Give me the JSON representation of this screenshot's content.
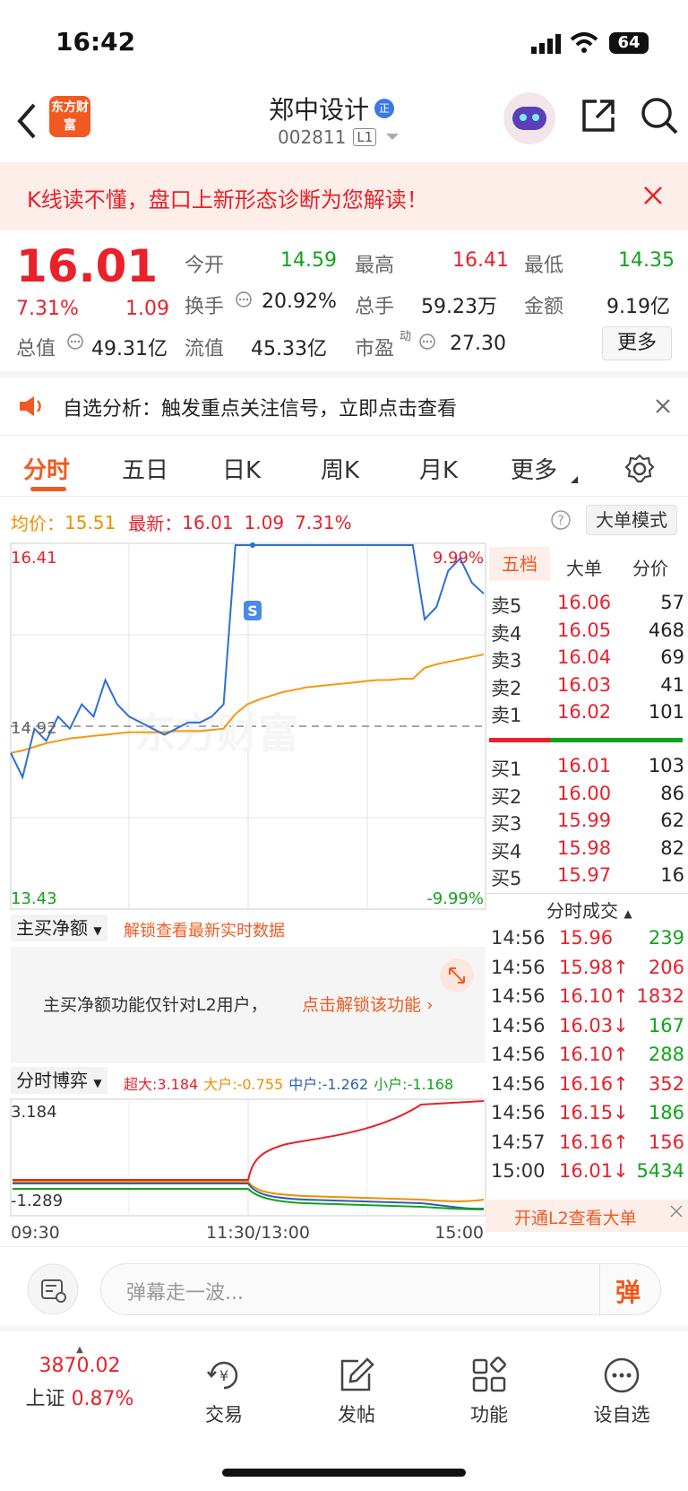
{
  "status": {
    "time": "16:42",
    "battery": "64"
  },
  "header": {
    "logo": "东方财富",
    "stock_name": "郑中设计",
    "stock_code": "002811",
    "level": "L1",
    "badge": "正"
  },
  "banner": {
    "text": "K线读不懂，盘口上新形态诊断为您解读！"
  },
  "quote": {
    "price": "16.01",
    "change_pct": "7.31%",
    "change": "1.09",
    "open_label": "今开",
    "open": "14.59",
    "high_label": "最高",
    "high": "16.41",
    "low_label": "最低",
    "low": "14.35",
    "turnover_label": "换手",
    "turnover": "20.92%",
    "volume_label": "总手",
    "volume": "59.23万",
    "amount_label": "金额",
    "amount": "9.19亿",
    "mcap_label": "总值",
    "mcap": "49.31亿",
    "float_label": "流值",
    "float": "45.33亿",
    "pe_label": "市盈",
    "pe_sup": "动",
    "pe": "27.30",
    "more_button": "更多"
  },
  "notice": {
    "text": "自选分析：触发重点关注信号，立即点击查看"
  },
  "tabs": [
    "分时",
    "五日",
    "日K",
    "周K",
    "月K",
    "更多"
  ],
  "info_line": {
    "avg_label": "均价：",
    "avg": "15.51",
    "last_label": "最新：",
    "last": "16.01",
    "change": "1.09",
    "pct": "7.31%",
    "mode_button": "大单模式"
  },
  "chart": {
    "top_price": "16.41",
    "top_pct": "9.99%",
    "bottom_price": "13.43",
    "bottom_pct": "-9.99%",
    "mid_label": "14.92",
    "signal": "S",
    "watermark": "东方财富",
    "times": [
      "09:30",
      "11:30/13:00",
      "15:00"
    ]
  },
  "chart_data": {
    "type": "line",
    "ylim": [
      13.43,
      16.41
    ],
    "series": [
      {
        "name": "price",
        "values": [
          14.7,
          14.5,
          14.9,
          14.8,
          15.0,
          14.9,
          15.1,
          15.0,
          15.3,
          15.1,
          15.0,
          14.95,
          14.9,
          14.85,
          14.9,
          14.95,
          14.95,
          15.0,
          15.1,
          16.41,
          16.41,
          16.41,
          16.41,
          16.41,
          16.41,
          16.41,
          16.41,
          16.41,
          16.41,
          16.41,
          16.41,
          16.41,
          16.41,
          16.41,
          16.41,
          15.8,
          15.9,
          16.2,
          16.3,
          16.1,
          16.01
        ]
      },
      {
        "name": "avg",
        "values": [
          14.7,
          14.72,
          14.75,
          14.78,
          14.8,
          14.82,
          14.83,
          14.84,
          14.85,
          14.86,
          14.87,
          14.87,
          14.87,
          14.87,
          14.88,
          14.88,
          14.88,
          14.89,
          14.9,
          15.02,
          15.1,
          15.14,
          15.17,
          15.2,
          15.22,
          15.24,
          15.25,
          15.26,
          15.27,
          15.28,
          15.29,
          15.3,
          15.3,
          15.31,
          15.31,
          15.4,
          15.43,
          15.45,
          15.47,
          15.49,
          15.51
        ]
      }
    ]
  },
  "mainbuy": {
    "label": "主买净额",
    "unlock": "解锁查看最新实时数据",
    "msg": "主买净额功能仅针对L2用户，",
    "link": "点击解锁该功能"
  },
  "game": {
    "label": "分时博弈",
    "super": "超大:3.184",
    "large": "大户:-0.755",
    "mid": "中户:-1.262",
    "small": "小户:-1.168",
    "top": "3.184",
    "bottom": "-1.289"
  },
  "orderbook": {
    "tabs": [
      "五档",
      "大单",
      "分价"
    ],
    "asks": [
      {
        "label": "卖5",
        "price": "16.06",
        "vol": "57"
      },
      {
        "label": "卖4",
        "price": "16.05",
        "vol": "468"
      },
      {
        "label": "卖3",
        "price": "16.04",
        "vol": "69"
      },
      {
        "label": "卖2",
        "price": "16.03",
        "vol": "41"
      },
      {
        "label": "卖1",
        "price": "16.02",
        "vol": "101"
      }
    ],
    "bids": [
      {
        "label": "买1",
        "price": "16.01",
        "vol": "103"
      },
      {
        "label": "买2",
        "price": "16.00",
        "vol": "86"
      },
      {
        "label": "买3",
        "price": "15.99",
        "vol": "62"
      },
      {
        "label": "买4",
        "price": "15.98",
        "vol": "82"
      },
      {
        "label": "买5",
        "price": "15.97",
        "vol": "16"
      }
    ],
    "ticks_title": "分时成交",
    "ticks": [
      {
        "t": "14:56",
        "p": "15.96",
        "arrow": "",
        "v": "239",
        "pc": "red",
        "vc": "green"
      },
      {
        "t": "14:56",
        "p": "15.98↑",
        "arrow": "",
        "v": "206",
        "pc": "red",
        "vc": "red"
      },
      {
        "t": "14:56",
        "p": "16.10↑",
        "arrow": "",
        "v": "1832",
        "pc": "red",
        "vc": "red"
      },
      {
        "t": "14:56",
        "p": "16.03↓",
        "arrow": "",
        "v": "167",
        "pc": "red",
        "vc": "green"
      },
      {
        "t": "14:56",
        "p": "16.10↑",
        "arrow": "",
        "v": "288",
        "pc": "red",
        "vc": "green"
      },
      {
        "t": "14:56",
        "p": "16.16↑",
        "arrow": "",
        "v": "352",
        "pc": "red",
        "vc": "red"
      },
      {
        "t": "14:56",
        "p": "16.15↓",
        "arrow": "",
        "v": "186",
        "pc": "red",
        "vc": "green"
      },
      {
        "t": "14:57",
        "p": "16.16↑",
        "arrow": "",
        "v": "156",
        "pc": "red",
        "vc": "red"
      },
      {
        "t": "15:00",
        "p": "16.01↓",
        "arrow": "",
        "v": "5434",
        "pc": "red",
        "vc": "green"
      }
    ],
    "l2_promo": "开通L2查看大单"
  },
  "comment": {
    "placeholder": "弹幕走一波...",
    "danmu": "弹"
  },
  "tabbar": {
    "index_value": "3870.02",
    "index_name": "上证",
    "index_pct": "0.87%",
    "items": [
      "交易",
      "发帖",
      "功能",
      "设自选"
    ]
  }
}
